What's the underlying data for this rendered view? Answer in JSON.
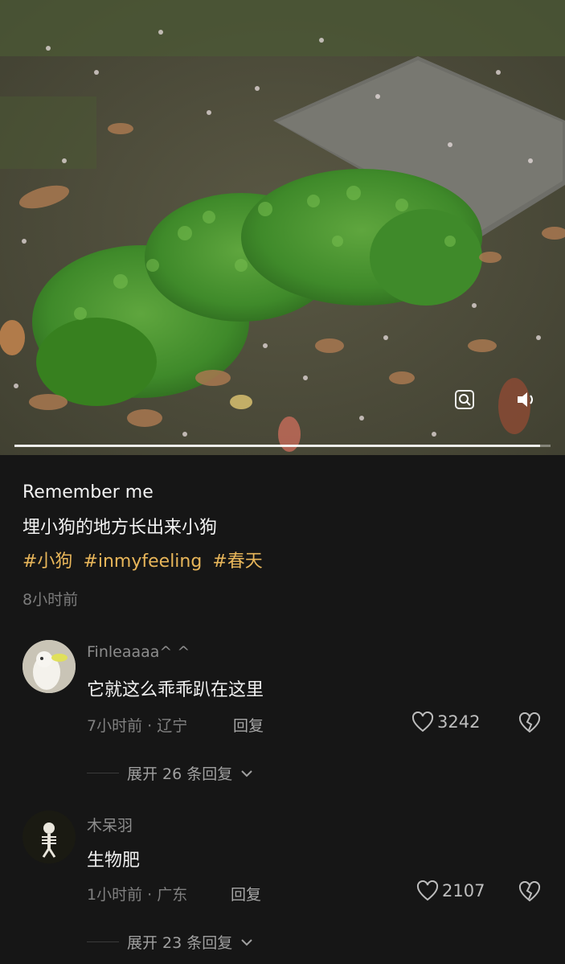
{
  "media": {
    "zoom_icon": "zoom-search-icon",
    "volume_icon": "volume-icon",
    "progress": 0.98
  },
  "post": {
    "title": "Remember me",
    "body": "埋小狗的地方长出来小狗",
    "tags": [
      "#小狗",
      "#inmyfeeling",
      "#春天"
    ],
    "time": "8小时前"
  },
  "comments": [
    {
      "user": "Finleaaaa^ ^",
      "text": "它就这么乖乖趴在这里",
      "meta": "7小时前 · 辽宁",
      "reply_label": "回复",
      "likes": "3242",
      "expand_label": "展开 26 条回复"
    },
    {
      "user": "木呆羽",
      "text": "生物肥",
      "meta": "1小时前 · 广东",
      "reply_label": "回复",
      "likes": "2107",
      "expand_label": "展开 23 条回复"
    }
  ],
  "colors": {
    "background": "#161616",
    "tag": "#e8b65a"
  }
}
